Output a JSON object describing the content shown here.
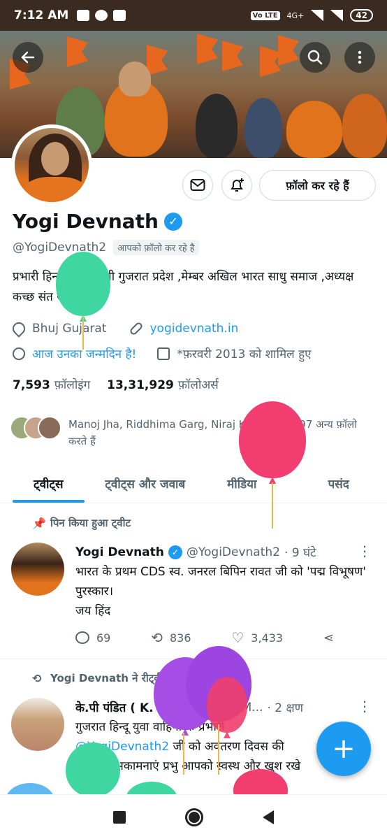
{
  "status_bar": {
    "time": "7:12 AM",
    "network": "4G+",
    "volte": "Vo LTE",
    "battery": "42"
  },
  "profile": {
    "name": "Yogi Devnath",
    "handle": "@YogiDevnath2",
    "follows_you": "आपको फ़ॉलो कर रहे है",
    "bio": "प्रभारी हिन्दू युवा वाहिनी गुजरात प्रदेश ,मेम्बर अखिल भारत साधु समाज ,अध्यक्ष कच्छ संत समाज",
    "location": "Bhuj Gujarat",
    "website": "yogidevnath.in",
    "birthday": "आज उनका जन्मदिन है!",
    "joined": "*फ़रवरी 2013 को शामिल हुए",
    "following_count": "7,593",
    "following_label": "फ़ॉलोइंग",
    "followers_count": "13,31,929",
    "followers_label": "फ़ॉलोअर्स",
    "known_followers": "Manoj Jha, Riddhima Garg, Niraj Keshri और 997 अन्य फ़ॉलो करते हैं",
    "follow_button": "फ़ॉलो कर रहे हैं"
  },
  "tabs": [
    "ट्वीट्स",
    "ट्वीट्स और जवाब",
    "मीडिया",
    "पसंद"
  ],
  "pinned_label": "पिन किया हुआ ट्वीट",
  "tweet1": {
    "name": "Yogi Devnath",
    "handle": "@YogiDevnath2",
    "time": "· 9 घंटे",
    "line1": "भारत के प्रथम CDS स्व. जनरल बिपिन रावत जी को 'पद्म विभूषण' पुरस्कार।",
    "line2": "जय हिंद",
    "replies": "69",
    "retweets": "836",
    "likes": "3,433"
  },
  "retweet_context": "Yogi Devnath ने रीट्वीट किया",
  "tweet2": {
    "name": "के.पी पंडित ( K. P. Pandit )",
    "handle": "@M...",
    "time": "· 2 क्षण",
    "text_a": "गुजरात हिन्दू युवा वाहिनी के प्रभारी",
    "mention": "@YogiDevnath2",
    "text_b": "जी को अवतरण दिवस की हार्दिक शुभकामनाएं प्रभु आपको स्वस्थ और खुश रखे🙏"
  },
  "icons": {
    "back": "arrow-left-icon",
    "search": "search-icon",
    "more": "more-vertical-icon",
    "message": "envelope-icon",
    "notify": "bell-plus-icon",
    "compose": "plus-icon"
  },
  "colors": {
    "accent": "#1d9bf0",
    "text": "#0f1419",
    "muted": "#536471"
  }
}
